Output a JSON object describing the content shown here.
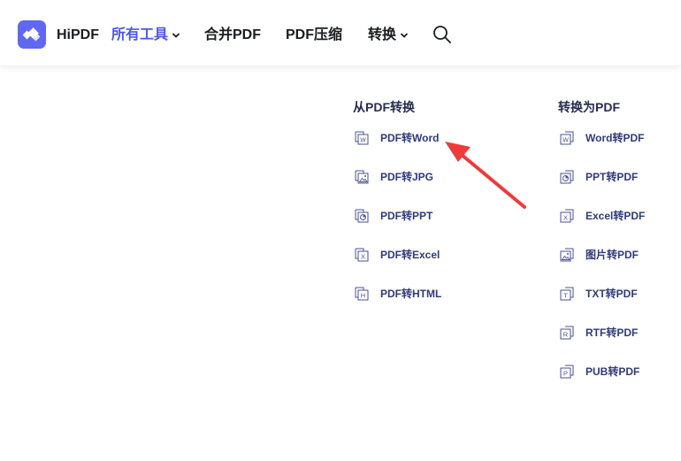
{
  "header": {
    "brand": "HiPDF",
    "nav": [
      {
        "label": "所有工具",
        "has_dropdown": true,
        "active": true
      },
      {
        "label": "合并PDF",
        "has_dropdown": false,
        "active": false
      },
      {
        "label": "PDF压缩",
        "has_dropdown": false,
        "active": false
      },
      {
        "label": "转换",
        "has_dropdown": true,
        "active": false
      }
    ],
    "search_icon": "search-icon"
  },
  "colors": {
    "accent": "#4b57e8",
    "logo_bg": "#5f68f2",
    "menu_text": "#2f3a78",
    "annotation_arrow": "#ef3b3b"
  },
  "menu": {
    "from_pdf": {
      "title": "从PDF转换",
      "items": [
        {
          "label": "PDF转Word",
          "icon": "word-file-icon"
        },
        {
          "label": "PDF转JPG",
          "icon": "image-file-icon"
        },
        {
          "label": "PDF转PPT",
          "icon": "ppt-file-icon"
        },
        {
          "label": "PDF转Excel",
          "icon": "excel-file-icon"
        },
        {
          "label": "PDF转HTML",
          "icon": "html-file-icon"
        }
      ]
    },
    "to_pdf": {
      "title": "转换为PDF",
      "items": [
        {
          "label": "Word转PDF",
          "icon": "word-file-icon"
        },
        {
          "label": "PPT转PDF",
          "icon": "ppt-file-icon"
        },
        {
          "label": "Excel转PDF",
          "icon": "excel-file-icon"
        },
        {
          "label": "图片转PDF",
          "icon": "image-file-icon"
        },
        {
          "label": "TXT转PDF",
          "icon": "txt-file-icon"
        },
        {
          "label": "RTF转PDF",
          "icon": "rtf-file-icon"
        },
        {
          "label": "PUB转PDF",
          "icon": "pub-file-icon"
        }
      ]
    }
  }
}
